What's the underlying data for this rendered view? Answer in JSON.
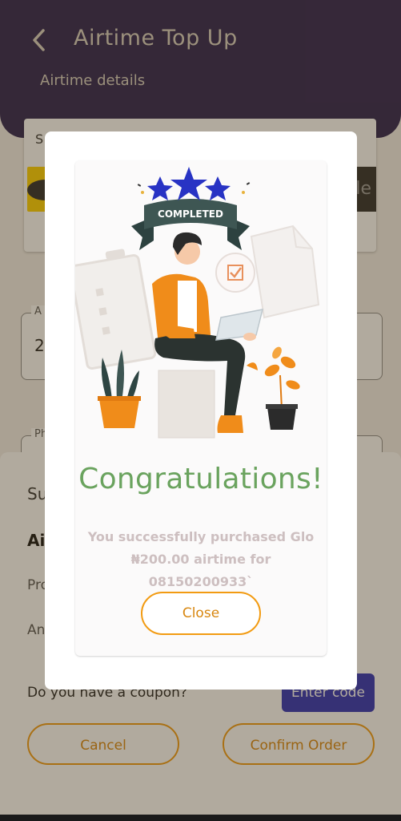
{
  "header": {
    "title": "Airtime Top Up",
    "subtitle": "Airtime details",
    "back_icon": "arrow-left-icon"
  },
  "background": {
    "card_partial_label": "S",
    "dark_tile_partial": "ile",
    "amount_field_partial_label": "A",
    "amount_field_partial_value": "2",
    "phone_field_partial_label": "Ph"
  },
  "summary_sheet": {
    "heading_partial": "Su",
    "bold_partial": "Air",
    "row1_partial": "Pro",
    "row2_partial": "An",
    "coupon_prompt": "Do you have a coupon?",
    "enter_code_label": "Enter code",
    "cancel_label": "Cancel",
    "confirm_label": "Confirm Order"
  },
  "dialog": {
    "illustration_badge": "COMPLETED",
    "heading": "Congratulations!",
    "message_line1": "You successfully purchased Glo",
    "message_line2": "₦200.00 airtime for 08150200933`",
    "close_label": "Close"
  },
  "colors": {
    "header_bg": "#2a2050",
    "accent_orange": "#f29b12",
    "success_green": "#6aa35e",
    "enter_code_bg": "#2b2fb8"
  }
}
